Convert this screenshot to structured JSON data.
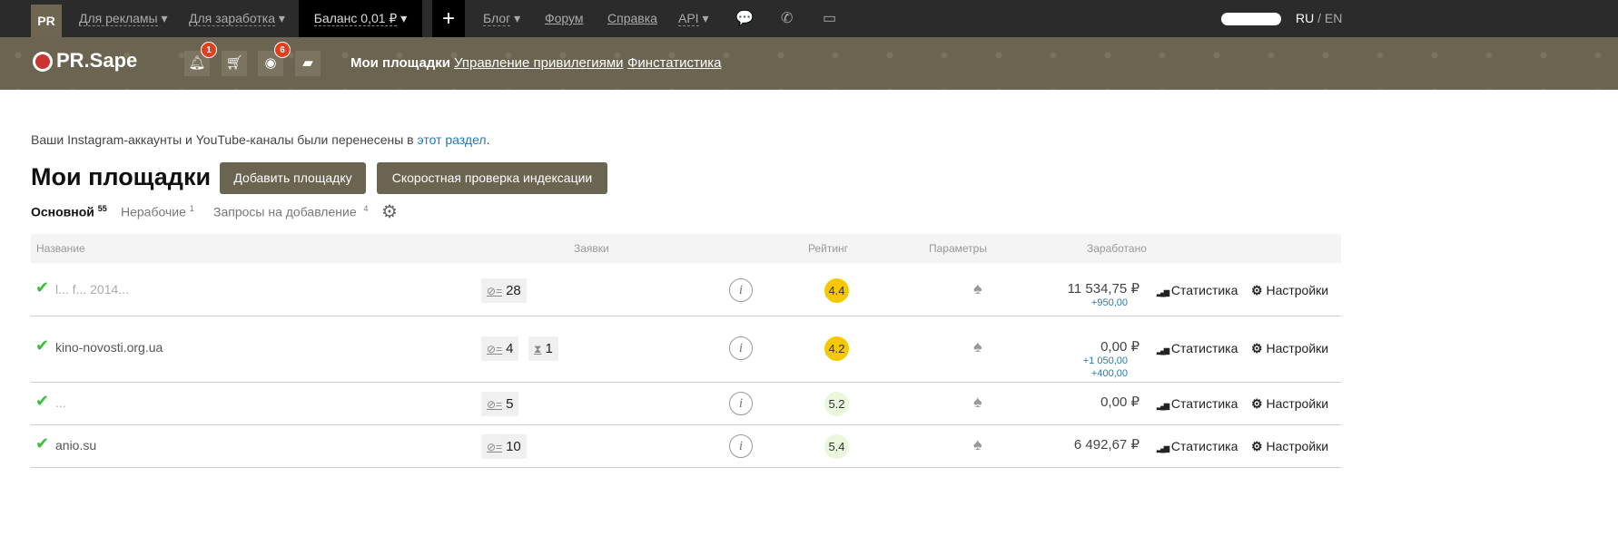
{
  "topbar": {
    "pr": "PR",
    "advertise": "Для рекламы",
    "earn": "Для заработка",
    "balance": "Баланс 0,01 ₽",
    "plus": "+",
    "blog": "Блог",
    "forum": "Форум",
    "help": "Справка",
    "api": "API",
    "lang_ru": "RU",
    "lang_sep": "/",
    "lang_en": "EN"
  },
  "header": {
    "logo": "PR.Sape",
    "notif_count": "1",
    "views_count": "6",
    "nav": [
      "Мои площадки",
      "Управление привилегиями",
      "Финстатистика"
    ]
  },
  "notice": {
    "text": "Ваши Instagram-аккаунты и YouTube-каналы были перенесены в ",
    "link": "этот раздел",
    "end": "."
  },
  "page": {
    "title": "Мои площадки",
    "add_button": "Добавить площадку",
    "check_button": "Скоростная проверка индексации"
  },
  "tabs": [
    {
      "label": "Основной",
      "count": "55"
    },
    {
      "label": "Нерабочие",
      "count": "1"
    },
    {
      "label": "Запросы на добавление",
      "count": "4"
    }
  ],
  "table": {
    "columns": [
      "Название",
      "Заявки",
      "Рейтинг",
      "Параметры",
      "Заработано"
    ],
    "stat_label": "Статистика",
    "settings_label": "Настройки",
    "rows": [
      {
        "site": "l...  f...  2014...",
        "req": "28",
        "wait": null,
        "rating": "4.4",
        "rating_color": "#f5c800",
        "earned": "11 534,75 ₽",
        "extra": [
          "+950,00"
        ]
      },
      {
        "site": "kino-novosti.org.ua",
        "req": "4",
        "wait": "1",
        "rating": "4.2",
        "rating_color": "#f5c800",
        "earned": "0,00 ₽",
        "extra": [
          "+1 050,00",
          "+400,00"
        ]
      },
      {
        "site": "...",
        "req": "5",
        "wait": null,
        "rating": "5.2",
        "rating_color": "#eaf7dc",
        "earned": "0,00 ₽",
        "extra": []
      },
      {
        "site": "anio.su",
        "req": "10",
        "wait": null,
        "rating": "5.4",
        "rating_color": "#eaf7dc",
        "earned": "6 492,67 ₽",
        "extra": []
      }
    ]
  }
}
